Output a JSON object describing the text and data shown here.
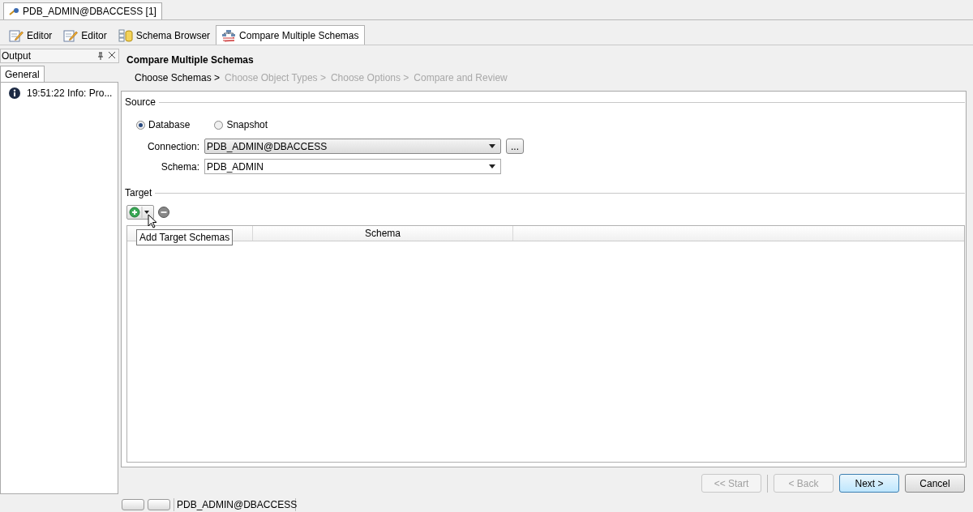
{
  "document_tab": {
    "label": "PDB_ADMIN@DBACCESS [1]"
  },
  "editor_tabs": [
    {
      "label": "Editor",
      "kind": "editor",
      "selected": false
    },
    {
      "label": "Editor",
      "kind": "editor",
      "selected": false
    },
    {
      "label": "Schema Browser",
      "kind": "browser",
      "selected": false
    },
    {
      "label": "Compare Multiple Schemas",
      "kind": "compare",
      "selected": true
    }
  ],
  "output_panel": {
    "title": "Output",
    "tabs": [
      {
        "label": "General",
        "selected": true
      }
    ],
    "messages": [
      "19:51:22 Info: Pro..."
    ]
  },
  "wizard": {
    "title": "Compare Multiple Schemas",
    "steps": [
      {
        "label": "Choose Schemas >",
        "selected": true
      },
      {
        "label": "Choose Object Types >",
        "selected": false
      },
      {
        "label": "Choose Options >",
        "selected": false
      },
      {
        "label": "Compare and Review",
        "selected": false
      }
    ],
    "source": {
      "legend": "Source",
      "modes": [
        {
          "label": "Database",
          "selected": true
        },
        {
          "label": "Snapshot",
          "selected": false
        }
      ],
      "connection_label": "Connection:",
      "connection": "PDB_ADMIN@DBACCESS",
      "browse_button": "...",
      "schema_label": "Schema:",
      "schema": "PDB_ADMIN"
    },
    "target": {
      "legend": "Target",
      "tooltip": "Add Target Schemas",
      "columns": [
        "Schema"
      ]
    },
    "buttons": [
      {
        "label": "<< Start",
        "disabled": true,
        "default": false
      },
      {
        "label": "< Back",
        "disabled": true,
        "default": false
      },
      {
        "label": "Next >",
        "disabled": false,
        "default": true
      },
      {
        "label": "Cancel",
        "disabled": false,
        "default": false
      }
    ]
  },
  "status_bar": {
    "connection": "PDB_ADMIN@DBACCESS"
  }
}
